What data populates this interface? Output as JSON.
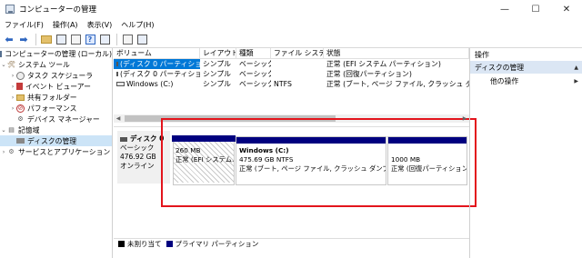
{
  "window": {
    "title": "コンピューターの管理",
    "min": "—",
    "max": "☐",
    "close": "✕"
  },
  "menu": [
    "ファイル(F)",
    "操作(A)",
    "表示(V)",
    "ヘルプ(H)"
  ],
  "tree": {
    "root": "コンピューターの管理 (ローカル)",
    "system_tools": "システム ツール",
    "task_scheduler": "タスク スケジューラ",
    "event_viewer": "イベント ビューアー",
    "shared_folders": "共有フォルダー",
    "performance": "パフォーマンス",
    "device_manager": "デバイス マネージャー",
    "storage": "記憶域",
    "disk_management": "ディスクの管理",
    "services_apps": "サービスとアプリケーション"
  },
  "columns": {
    "volume": "ボリューム",
    "layout": "レイアウト",
    "type": "種類",
    "fs": "ファイル システム",
    "status": "状態"
  },
  "volumes": [
    {
      "name": "(ディスク 0 パーティション 1)",
      "layout": "シンプル",
      "type": "ベーシック",
      "fs": "",
      "status": "正常 (EFI システム パーティション)"
    },
    {
      "name": "(ディスク 0 パーティション 4)",
      "layout": "シンプル",
      "type": "ベーシック",
      "fs": "",
      "status": "正常 (回復パーティション)"
    },
    {
      "name": "Windows (C:)",
      "layout": "シンプル",
      "type": "ベーシック",
      "fs": "NTFS",
      "status": "正常 (ブート, ページ ファイル, クラッシュ ダンプ, ベーシ"
    }
  ],
  "disk": {
    "name": "ディスク 0",
    "type": "ベーシック",
    "size": "476.92 GB",
    "state": "オンライン"
  },
  "partitions": [
    {
      "title": "",
      "size": "260 MB",
      "status": "正常 (EFI システム..."
    },
    {
      "title": "Windows (C:)",
      "size": "475.69 GB NTFS",
      "status": "正常 (ブート, ページ ファイル, クラッシュ ダンプ, ベーシ"
    },
    {
      "title": "",
      "size": "1000 MB",
      "status": "正常 (回復パーティション)"
    }
  ],
  "legend": {
    "unallocated": "未割り当て",
    "primary": "プライマリ パーティション"
  },
  "actions": {
    "header": "操作",
    "section": "ディスクの管理",
    "other": "他の操作"
  },
  "colors": {
    "partition_bar": "#00007f",
    "highlight": "#e3141c",
    "selection": "#0078d7"
  }
}
